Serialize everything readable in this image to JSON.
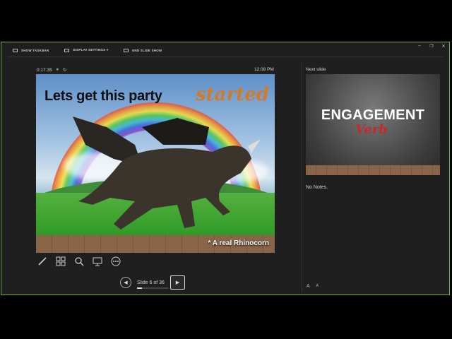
{
  "toolbar": {
    "show_taskbar": "SHOW TASKBAR",
    "display_settings": "DISPLAY SETTINGS ▾",
    "end_slide_show": "END SLIDE SHOW"
  },
  "window_controls": {
    "minimize": "–",
    "restore": "❐",
    "close": "✕"
  },
  "presenter": {
    "timer": "0:17:35",
    "pause_glyph": "⏸",
    "reset_glyph": "↻",
    "clock": "12:08 PM"
  },
  "current_slide": {
    "title": "Lets get this party",
    "title_accent": "started",
    "caption": "* A real Rhinocorn"
  },
  "tools": [
    {
      "name": "pen-tool-icon"
    },
    {
      "name": "see-all-slides-icon"
    },
    {
      "name": "zoom-icon"
    },
    {
      "name": "black-screen-icon"
    },
    {
      "name": "more-options-icon"
    }
  ],
  "navigation": {
    "prev_glyph": "◀",
    "counter": "Slide 6 of 36",
    "progress": 0.167,
    "next_glyph": "▶"
  },
  "next_slide": {
    "label": "Next slide",
    "title": "ENGAGEMENT",
    "subtitle": "Verb"
  },
  "notes": "No Notes.",
  "font_buttons": {
    "increase": "A",
    "decrease": "A"
  },
  "colors": {
    "accent_border": "#7bb024",
    "background": "#1f1f1f"
  }
}
